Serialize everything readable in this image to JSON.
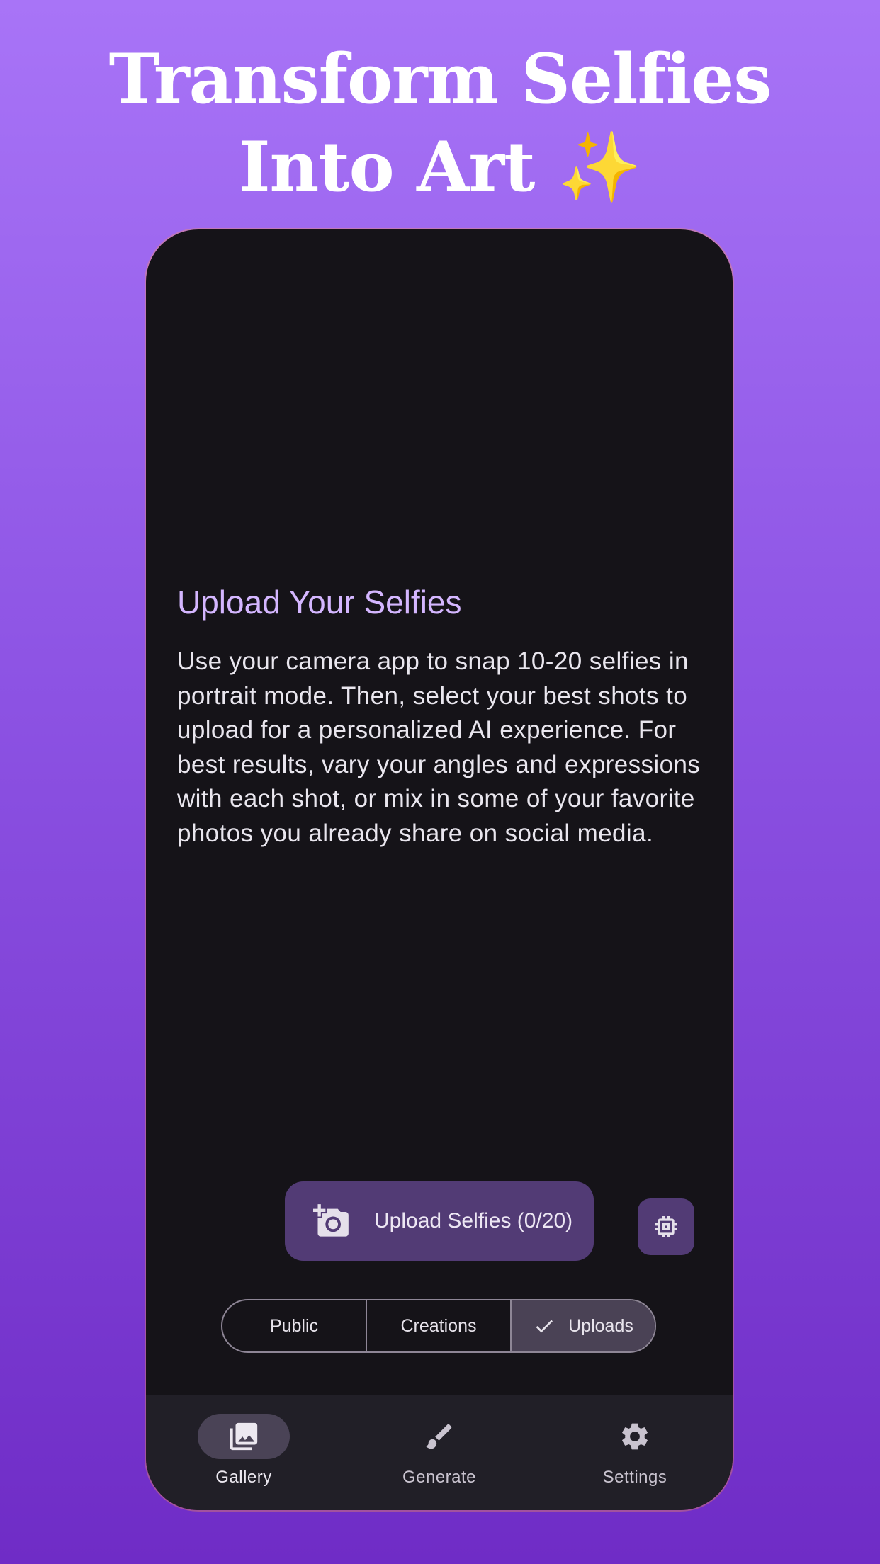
{
  "headline": {
    "line1": "Transform Selfies",
    "line2": "Into Art",
    "emoji": "✨"
  },
  "card": {
    "title": "Upload Your Selfies",
    "body": "Use your camera app to snap 10-20 selfies in portrait mode. Then, select your best shots to upload for a personalized AI experience. For best results, vary your angles and expressions with each shot, or mix in some of your favorite photos you already share on social media."
  },
  "upload_button": {
    "label": "Upload Selfies (0/20)",
    "icon": "add-camera-icon"
  },
  "chip_button": {
    "icon": "cpu-chip-icon"
  },
  "segments": [
    {
      "label": "Public",
      "selected": false
    },
    {
      "label": "Creations",
      "selected": false
    },
    {
      "label": "Uploads",
      "selected": true
    }
  ],
  "bottom_nav": [
    {
      "label": "Gallery",
      "icon": "gallery-icon",
      "active": true
    },
    {
      "label": "Generate",
      "icon": "brush-icon",
      "active": false
    },
    {
      "label": "Settings",
      "icon": "gear-icon",
      "active": false
    }
  ],
  "colors": {
    "accent": "#d4b6ff",
    "button": "#523b75",
    "phone_bg": "#151318",
    "nav_bg": "#211f27"
  }
}
